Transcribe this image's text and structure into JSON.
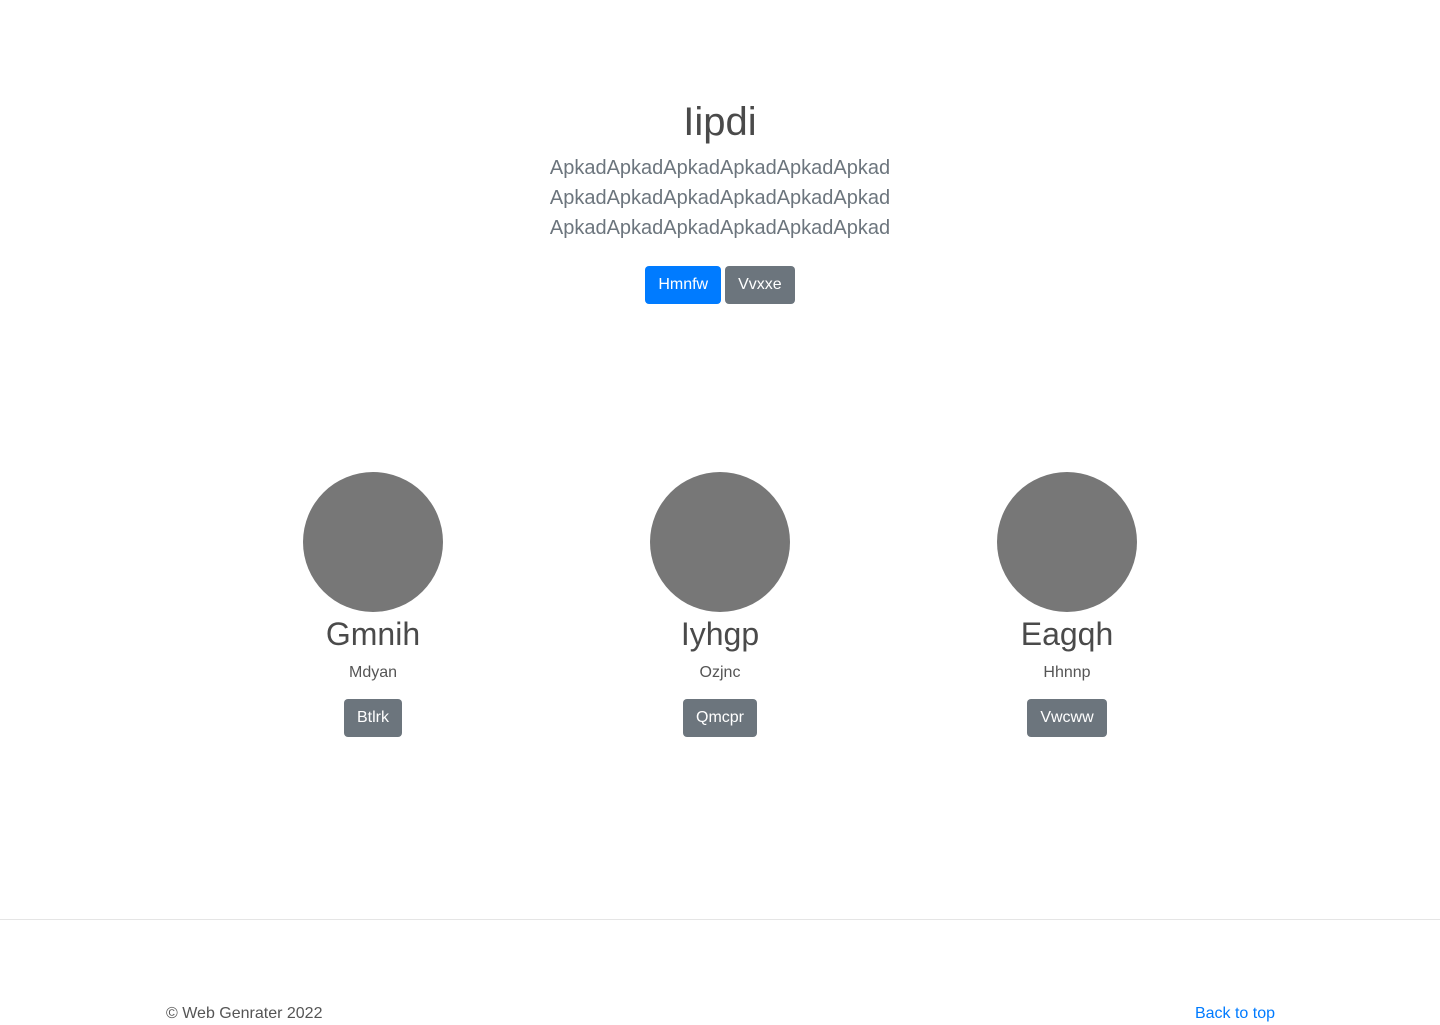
{
  "hero": {
    "title": "Iipdi",
    "lead_lines": [
      "ApkadApkadApkadApkadApkadApkad",
      "ApkadApkadApkadApkadApkadApkad",
      "ApkadApkadApkadApkadApkadApkad"
    ],
    "primary_button": "Hmnfw",
    "secondary_button": "Vvxxe"
  },
  "cards": [
    {
      "name": "Gmnih",
      "subtitle": "Mdyan",
      "button": "Btlrk"
    },
    {
      "name": "Iyhgp",
      "subtitle": "Ozjnc",
      "button": "Qmcpr"
    },
    {
      "name": "Eagqh",
      "subtitle": "Hhnnp",
      "button": "Vwcww"
    }
  ],
  "footer": {
    "copyright": "© Web Genrater 2022",
    "back_to_top": "Back to top"
  },
  "colors": {
    "primary": "#007bff",
    "secondary": "#6c757d",
    "avatar": "#777777"
  }
}
